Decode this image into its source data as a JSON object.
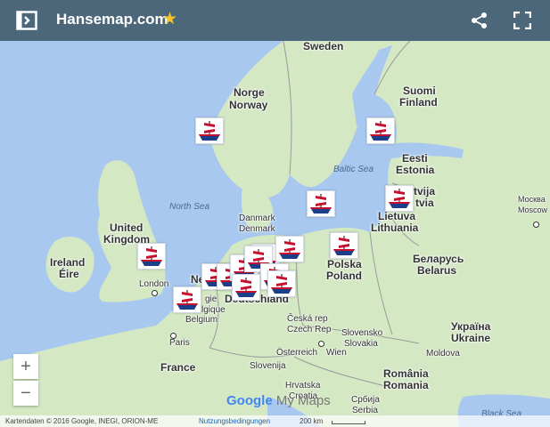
{
  "app": {
    "title": "Hansemap.com",
    "star": "★"
  },
  "icons": {
    "panel": "panel-toggle-icon",
    "share": "share-icon",
    "fullscreen": "fullscreen-icon"
  },
  "colors": {
    "topbar": "#4b6779",
    "star": "#f7c325",
    "water": "#a8c8f0",
    "land": "#d4e8c4"
  },
  "map": {
    "countries": [
      {
        "id": "sweden",
        "text": "Sweden"
      },
      {
        "id": "norge",
        "text": "Norge"
      },
      {
        "id": "norway",
        "text": "Norway"
      },
      {
        "id": "suomi",
        "text": "Suomi"
      },
      {
        "id": "finland",
        "text": "Finland"
      },
      {
        "id": "eesti",
        "text": "Eesti"
      },
      {
        "id": "estonia",
        "text": "Estonia"
      },
      {
        "id": "latvija",
        "text": "tvija"
      },
      {
        "id": "latvia",
        "text": "tvia"
      },
      {
        "id": "lietuva",
        "text": "Lietuva"
      },
      {
        "id": "lithuania",
        "text": "Lithuania"
      },
      {
        "id": "denmark",
        "text": "Danmark"
      },
      {
        "id": "denmark2",
        "text": "Denmark"
      },
      {
        "id": "uk1",
        "text": "United"
      },
      {
        "id": "uk2",
        "text": "Kingdom"
      },
      {
        "id": "ireland1",
        "text": "Ireland"
      },
      {
        "id": "ireland2",
        "text": "Éire"
      },
      {
        "id": "polska",
        "text": "Polska"
      },
      {
        "id": "poland",
        "text": "Poland"
      },
      {
        "id": "belarus1",
        "text": "Беларусь"
      },
      {
        "id": "belarus2",
        "text": "Belarus"
      },
      {
        "id": "deutschland",
        "text": "Deutschland"
      },
      {
        "id": "ukraina1",
        "text": "Україна"
      },
      {
        "id": "ukraina2",
        "text": "Ukraine"
      },
      {
        "id": "cesko1",
        "text": "Česká rep"
      },
      {
        "id": "cesko2",
        "text": "Czech Rep"
      },
      {
        "id": "slovensko1",
        "text": "Slovensko"
      },
      {
        "id": "slovensko2",
        "text": "Slovakia"
      },
      {
        "id": "france",
        "text": "France"
      },
      {
        "id": "osterreich",
        "text": "Österreich"
      },
      {
        "id": "romania1",
        "text": "România"
      },
      {
        "id": "romania2",
        "text": "Romania"
      },
      {
        "id": "moldova",
        "text": "Moldova"
      },
      {
        "id": "slovenija",
        "text": "Slovenija"
      },
      {
        "id": "hrvatska1",
        "text": "Hrvatska"
      },
      {
        "id": "hrvatska2",
        "text": "Croatia"
      },
      {
        "id": "srbija1",
        "text": "Србија"
      },
      {
        "id": "srbija2",
        "text": "Serbia"
      },
      {
        "id": "belgie",
        "text": "gie"
      },
      {
        "id": "belgique",
        "text": "lgique"
      },
      {
        "id": "belgium",
        "text": "Belgium"
      },
      {
        "id": "ne",
        "text": "Ne"
      }
    ],
    "seas": [
      {
        "id": "northsea",
        "text": "North Sea"
      },
      {
        "id": "balticsea",
        "text": "Baltic Sea"
      },
      {
        "id": "blacksea",
        "text": "Black Sea"
      }
    ],
    "cities": [
      {
        "id": "london",
        "text": "London"
      },
      {
        "id": "paris",
        "text": "Paris"
      },
      {
        "id": "wien",
        "text": "Wien"
      },
      {
        "id": "moskva1",
        "text": "Москва"
      },
      {
        "id": "moskva2",
        "text": "Moscow"
      }
    ],
    "logo": {
      "google": "Google",
      "mymaps": "My Maps"
    }
  },
  "controls": {
    "zoom_in": "+",
    "zoom_out": "−"
  },
  "footer": {
    "attribution": "Kartendaten © 2016 Google, INEGI, ORION-ME",
    "terms": "Nutzungsbedingungen",
    "scale": "200 km"
  }
}
